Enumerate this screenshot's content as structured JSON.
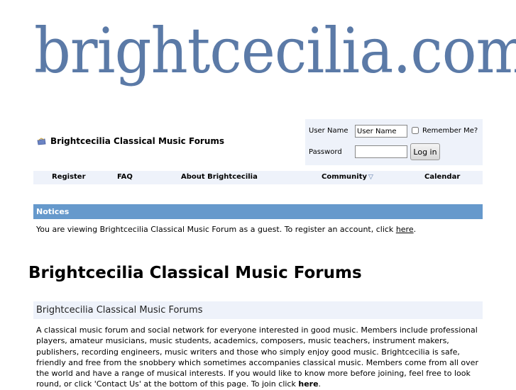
{
  "logo": {
    "text": "brightcecilia.com",
    "color": "#5b7aa7"
  },
  "forum": {
    "title": "Brightcecilia Classical Music Forums",
    "icon": "forum-icon"
  },
  "login": {
    "username_label": "User Name",
    "username_value": "User Name",
    "password_label": "Password",
    "password_value": "",
    "remember_label": "Remember Me?",
    "remember_checked": false,
    "button_label": "Log in"
  },
  "nav": {
    "register": "Register",
    "faq": "FAQ",
    "about": "About Brightcecilia",
    "community": "Community",
    "calendar": "Calendar"
  },
  "notices": {
    "header": "Notices",
    "text_before": "You are viewing Brightcecilia Classical Music Forum as a guest. To register an account, click ",
    "link": "here",
    "text_after": "."
  },
  "page": {
    "title": "Brightcecilia Classical Music Forums",
    "section_header": "Brightcecilia Classical Music Forums",
    "description": "A classical music forum and social network for everyone interested in good music. Members include professional players, amateur musicians, music students, academics, composers, music teachers, instrument makers, publishers, recording engineers, music writers and those who simply enjoy good music. Brightcecilia is safe, friendly and free from the snobbery which sometimes accompanies classical music. Members come from all over the world and have a range of musical interests. If you would like to know more before joining, feel free to look round, or click 'Contact Us' at the bottom of this page. To join click ",
    "description_link": "here",
    "description_end": "."
  },
  "colors": {
    "accent": "#6699cc",
    "panel": "#eef2fa",
    "logo": "#5b7aa7"
  }
}
